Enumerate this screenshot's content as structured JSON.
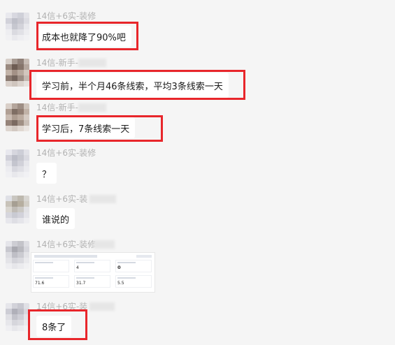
{
  "messages": [
    {
      "sender": "14信+6实-装修",
      "text": "成本也就降了90%吧"
    },
    {
      "sender": "14信-新手-",
      "text": "学习前，半个月46条线索，平均3条线索一天"
    },
    {
      "sender": "14信-新手-",
      "text": "学习后，7条线索一天"
    },
    {
      "sender": "14信+6实-装修",
      "text": "？"
    },
    {
      "sender": "14信+6实-装",
      "text": "谁说的"
    },
    {
      "sender": "14信+6实-装修",
      "text": ""
    },
    {
      "sender": "14信+6实-装",
      "text": "8条了"
    }
  ],
  "shared_image": {
    "values": [
      "4",
      "0",
      "0",
      "71.6",
      "31.7",
      "5.5"
    ]
  },
  "colors": {
    "highlight": "#e8262b",
    "background": "#f5f5f5",
    "bubble": "#ffffff",
    "name": "#b2b2b2"
  }
}
